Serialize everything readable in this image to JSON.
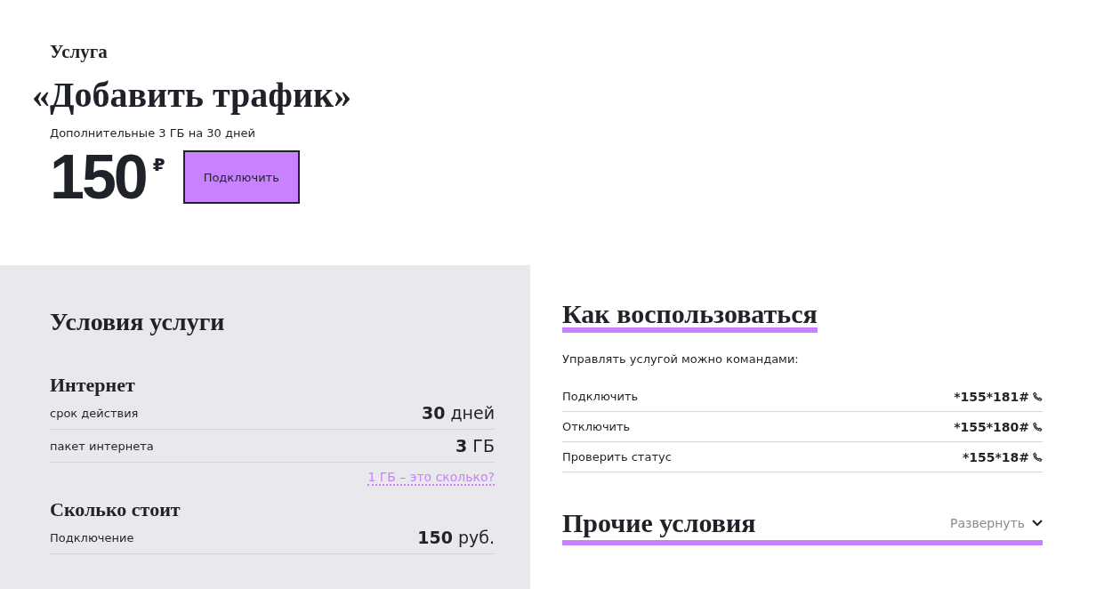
{
  "service": {
    "eyebrow": "Услуга",
    "title": "«Добавить трафик»",
    "subtitle": "Дополнительные 3 ГБ на 30 дней",
    "price": "150",
    "currency": "₽",
    "button": "Подключить"
  },
  "conditions": {
    "title": "Условия услуги",
    "groups": [
      {
        "title": "Интернет",
        "rows": [
          {
            "label": "срок действия",
            "value": "**30** дней"
          },
          {
            "label": "пакет интернета",
            "value": "**3** ГБ"
          }
        ],
        "link": "1 ГБ – это сколько?"
      },
      {
        "title": "Сколько стоит",
        "rows": [
          {
            "label": "Подключение",
            "value": "**150** руб."
          }
        ]
      }
    ]
  },
  "usage": {
    "title": "Как воспользоваться",
    "intro": "Управлять услугой можно командами:",
    "commands": [
      {
        "label": "Подключить",
        "code": "*155*181#"
      },
      {
        "label": "Отключить",
        "code": "*155*180#"
      },
      {
        "label": "Проверить статус",
        "code": "*155*18#"
      }
    ]
  },
  "other": {
    "title": "Прочие условия",
    "toggle": "Развернуть",
    "expanded": false
  }
}
